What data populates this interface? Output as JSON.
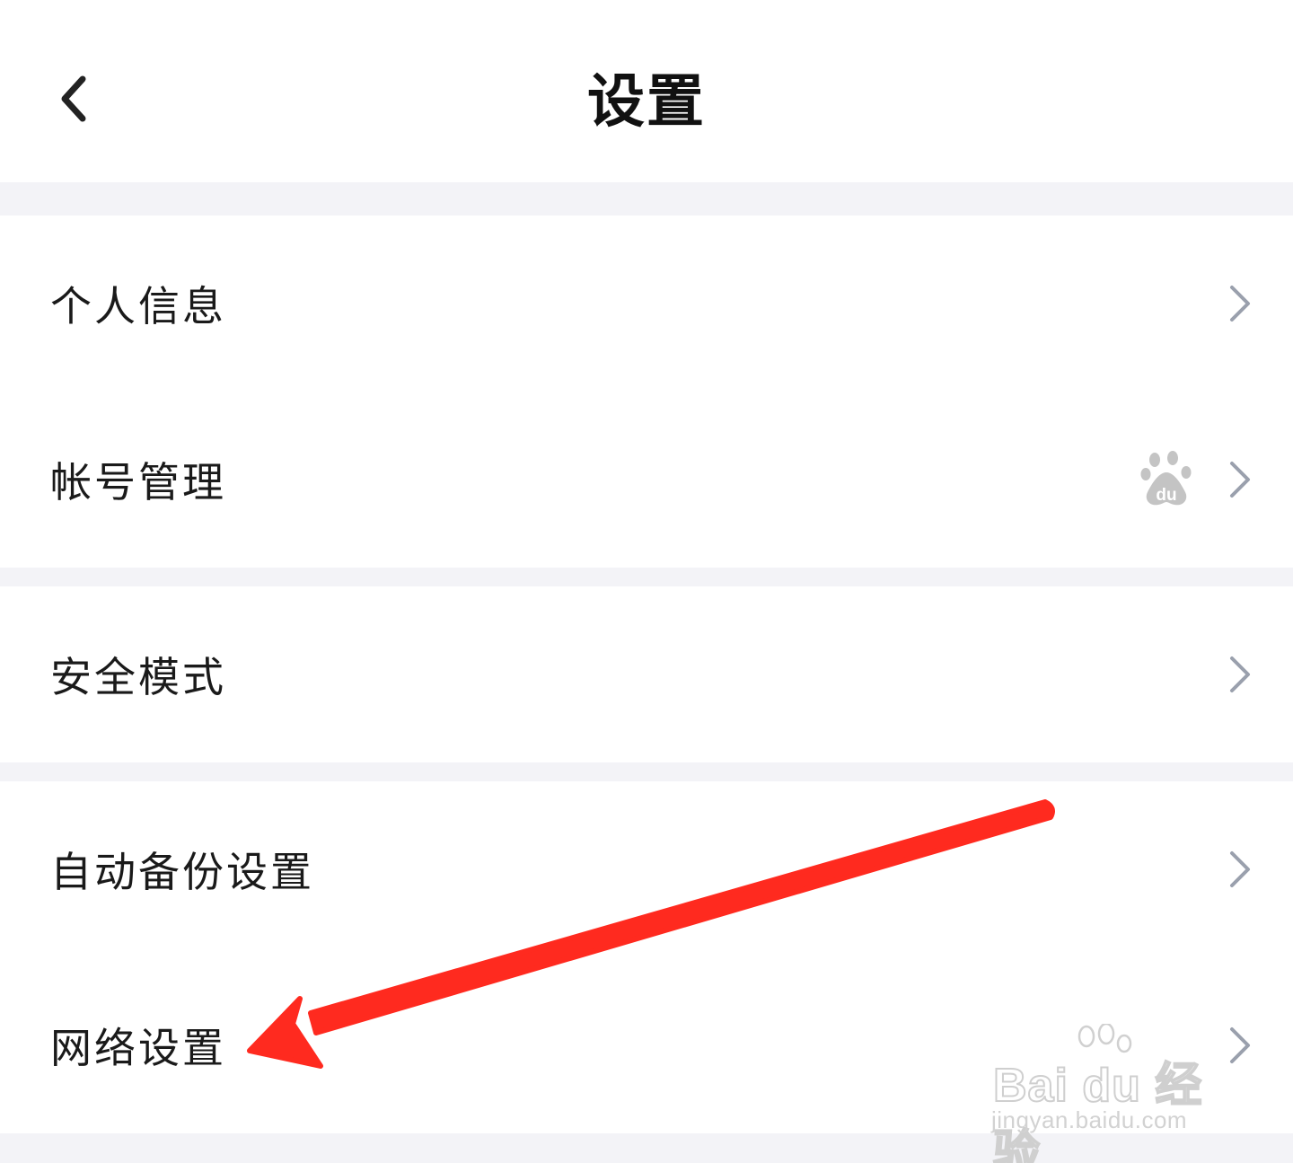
{
  "header": {
    "title": "设置",
    "back_icon": "chevron-left-icon"
  },
  "groups": [
    {
      "items": [
        {
          "label": "个人信息",
          "trailing_icon": "chevron-right-icon"
        },
        {
          "label": "帐号管理",
          "badge_icon": "baidu-paw-logo-icon",
          "badge_text": "du",
          "trailing_icon": "chevron-right-icon"
        }
      ]
    },
    {
      "items": [
        {
          "label": "安全模式",
          "trailing_icon": "chevron-right-icon"
        }
      ]
    },
    {
      "items": [
        {
          "label": "自动备份设置",
          "trailing_icon": "chevron-right-icon"
        },
        {
          "label": "网络设置",
          "trailing_icon": "chevron-right-icon"
        }
      ]
    }
  ],
  "annotation": {
    "type": "red-arrow",
    "points_to": "网络设置",
    "color": "#ff2a1f"
  },
  "watermark": {
    "brand": "Bai du 经验",
    "url": "jingyan.baidu.com"
  },
  "colors": {
    "page_background": "#f3f3f7",
    "card_background": "#ffffff",
    "text_primary": "#1a1a1a",
    "chevron": "#9aa0ad"
  }
}
